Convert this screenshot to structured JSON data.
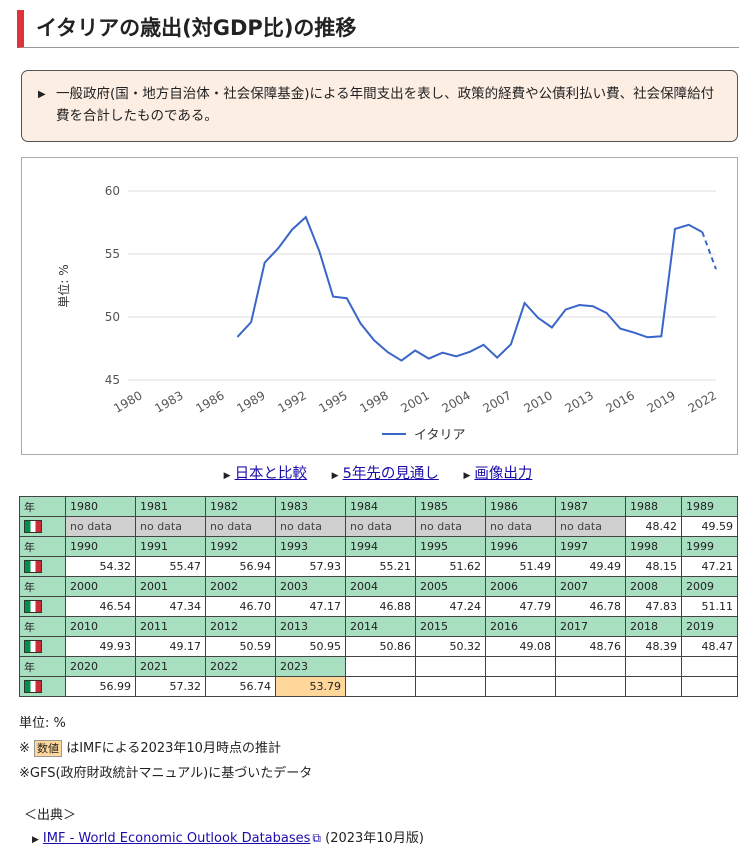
{
  "page": {
    "title": "イタリアの歳出(対GDP比)の推移",
    "note": "一般政府(国・地方自治体・社会保障基金)による年間支出を表し、政策的経費や公債利払い費、社会保障給付費を合計したものである。"
  },
  "chart_data": {
    "type": "line",
    "ylabel": "単位: %",
    "ylim": [
      45,
      60
    ],
    "yticks": [
      "45",
      "50",
      "55",
      "60"
    ],
    "xticks": [
      "1980",
      "1983",
      "1986",
      "1989",
      "1992",
      "1995",
      "1998",
      "2001",
      "2004",
      "2007",
      "2010",
      "2013",
      "2016",
      "2019",
      "2022"
    ],
    "x_range": [
      1980,
      2023
    ],
    "grid": true,
    "legend_position": "bottom",
    "line_color": "#3a66c8",
    "estimate_from": 2022,
    "series": [
      {
        "name": "イタリア",
        "x": [
          1988,
          1989,
          1990,
          1991,
          1992,
          1993,
          1994,
          1995,
          1996,
          1997,
          1998,
          1999,
          2000,
          2001,
          2002,
          2003,
          2004,
          2005,
          2006,
          2007,
          2008,
          2009,
          2010,
          2011,
          2012,
          2013,
          2014,
          2015,
          2016,
          2017,
          2018,
          2019,
          2020,
          2021,
          2022,
          2023
        ],
        "values": [
          48.42,
          49.59,
          54.32,
          55.47,
          56.94,
          57.93,
          55.21,
          51.62,
          51.49,
          49.49,
          48.15,
          47.21,
          46.54,
          47.34,
          46.7,
          47.17,
          46.88,
          47.24,
          47.79,
          46.78,
          47.83,
          51.11,
          49.93,
          49.17,
          50.59,
          50.95,
          50.86,
          50.32,
          49.08,
          48.76,
          48.39,
          48.47,
          56.99,
          57.32,
          56.74,
          53.79
        ]
      }
    ]
  },
  "links": {
    "compare": "日本と比較",
    "forecast": "5年先の見通し",
    "image": "画像出力"
  },
  "table": {
    "year_header": "年",
    "no_data_label": "no data",
    "rows": [
      {
        "years": [
          "1980",
          "1981",
          "1982",
          "1983",
          "1984",
          "1985",
          "1986",
          "1987",
          "1988",
          "1989"
        ],
        "values": [
          "no data",
          "no data",
          "no data",
          "no data",
          "no data",
          "no data",
          "no data",
          "no data",
          "48.42",
          "49.59"
        ]
      },
      {
        "years": [
          "1990",
          "1991",
          "1992",
          "1993",
          "1994",
          "1995",
          "1996",
          "1997",
          "1998",
          "1999"
        ],
        "values": [
          "54.32",
          "55.47",
          "56.94",
          "57.93",
          "55.21",
          "51.62",
          "51.49",
          "49.49",
          "48.15",
          "47.21"
        ]
      },
      {
        "years": [
          "2000",
          "2001",
          "2002",
          "2003",
          "2004",
          "2005",
          "2006",
          "2007",
          "2008",
          "2009"
        ],
        "values": [
          "46.54",
          "47.34",
          "46.70",
          "47.17",
          "46.88",
          "47.24",
          "47.79",
          "46.78",
          "47.83",
          "51.11"
        ]
      },
      {
        "years": [
          "2010",
          "2011",
          "2012",
          "2013",
          "2014",
          "2015",
          "2016",
          "2017",
          "2018",
          "2019"
        ],
        "values": [
          "49.93",
          "49.17",
          "50.59",
          "50.95",
          "50.86",
          "50.32",
          "49.08",
          "48.76",
          "48.39",
          "48.47"
        ]
      },
      {
        "years": [
          "2020",
          "2021",
          "2022",
          "2023"
        ],
        "values": [
          "56.99",
          "57.32",
          "56.74",
          "53.79"
        ]
      }
    ],
    "estimate_years": [
      "2023"
    ]
  },
  "footnotes": {
    "unit": "単位: %",
    "estimate_prefix": "※",
    "estimate_badge": "数値",
    "estimate_text": "はIMFによる2023年10月時点の推計",
    "gfs_note": "※GFS(政府財政統計マニュアル)に基づいたデータ",
    "source_heading": "＜出典＞",
    "source_link": "IMF - World Economic Outlook Databases",
    "source_date": "(2023年10月版)"
  }
}
